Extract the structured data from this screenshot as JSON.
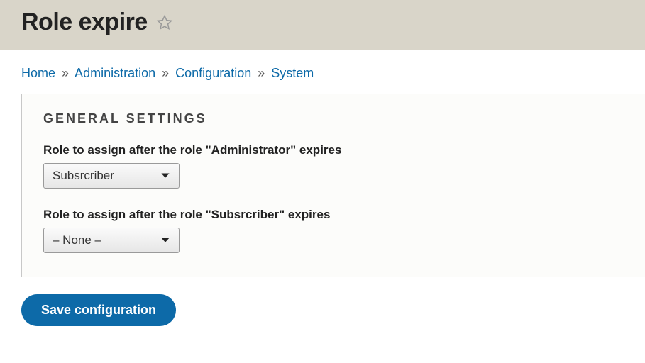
{
  "header": {
    "title": "Role expire"
  },
  "breadcrumb": {
    "items": [
      {
        "label": "Home"
      },
      {
        "label": "Administration"
      },
      {
        "label": "Configuration"
      },
      {
        "label": "System"
      }
    ],
    "separator": "»"
  },
  "fieldset": {
    "legend": "GENERAL SETTINGS",
    "items": [
      {
        "label": "Role to assign after the role \"Administrator\" expires",
        "selected": "Subsrcriber"
      },
      {
        "label": "Role to assign after the role \"Subsrcriber\" expires",
        "selected": "– None –"
      }
    ]
  },
  "actions": {
    "save_label": "Save configuration"
  }
}
